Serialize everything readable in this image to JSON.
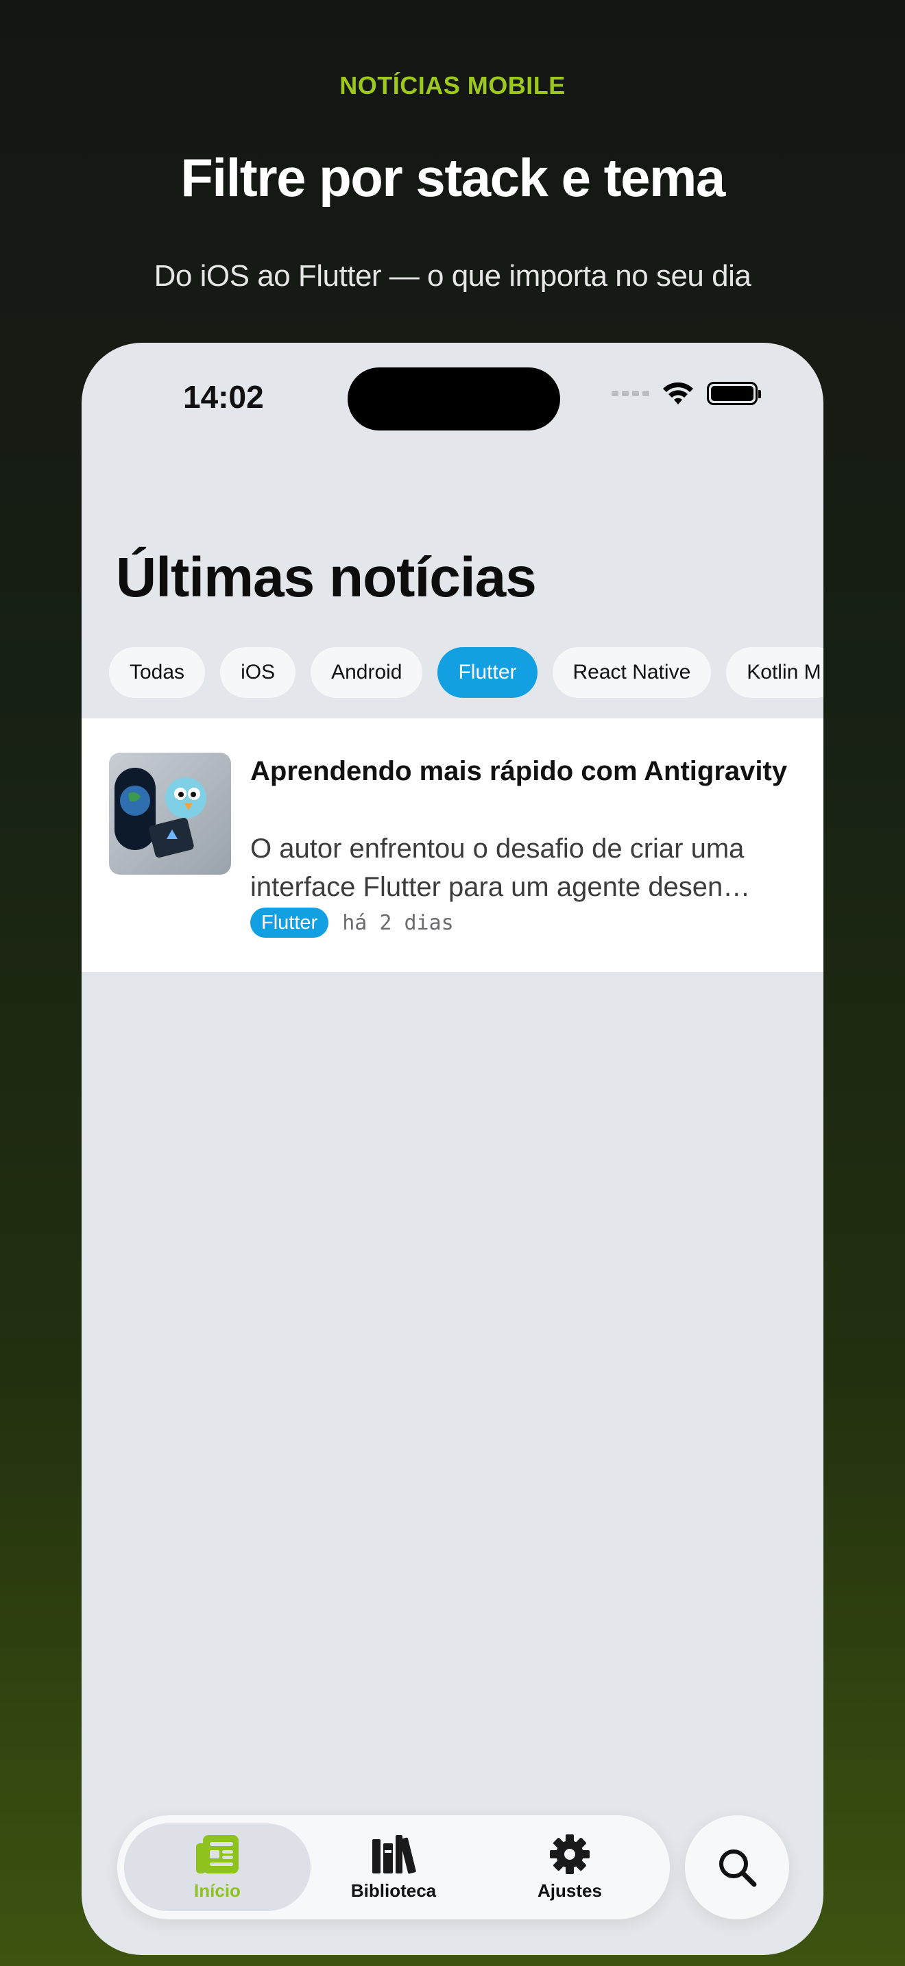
{
  "promo": {
    "eyebrow": "NOTÍCIAS MOBILE",
    "headline": "Filtre por stack e tema",
    "subline": "Do iOS ao Flutter — o que importa no seu dia"
  },
  "status_bar": {
    "time": "14:02",
    "icons": [
      "cellular-icon",
      "wifi-icon",
      "battery-icon"
    ]
  },
  "screen": {
    "title": "Últimas notícias",
    "filters": [
      {
        "label": "Todas",
        "active": false
      },
      {
        "label": "iOS",
        "active": false
      },
      {
        "label": "Android",
        "active": false
      },
      {
        "label": "Flutter",
        "active": true
      },
      {
        "label": "React Native",
        "active": false
      },
      {
        "label": "Kotlin M",
        "active": false
      }
    ],
    "articles": [
      {
        "title": "Aprendendo mais rápido com Antigravity",
        "excerpt": "O autor enfrentou o desafio de criar uma interface Flutter para um agente desen…",
        "tag": "Flutter",
        "time_ago": "há 2 dias"
      }
    ]
  },
  "tab_bar": {
    "tabs": [
      {
        "label": "Início",
        "icon": "newspaper-icon",
        "active": true
      },
      {
        "label": "Biblioteca",
        "icon": "books-icon",
        "active": false
      },
      {
        "label": "Ajustes",
        "icon": "gear-icon",
        "active": false
      }
    ],
    "search_icon": "search-icon"
  },
  "colors": {
    "accent_green": "#9dc81d",
    "accent_blue": "#12a0e3",
    "screen_bg": "#e3e6ea"
  }
}
